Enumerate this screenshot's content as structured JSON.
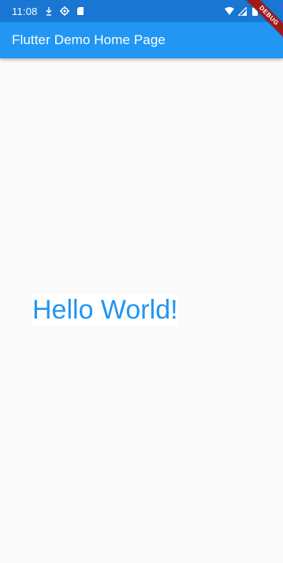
{
  "status_bar": {
    "time": "11:08",
    "left_icons": [
      "download-icon",
      "settings-icon",
      "sd-card-icon"
    ],
    "right_icons": [
      "wifi-icon",
      "cellular-icon",
      "battery-icon"
    ]
  },
  "app_bar": {
    "title": "Flutter Demo Home Page",
    "color": "#2196f3"
  },
  "body": {
    "text": "Hello World!",
    "text_color": "#2196f3"
  },
  "debug_banner": {
    "label": "DEBUG"
  }
}
